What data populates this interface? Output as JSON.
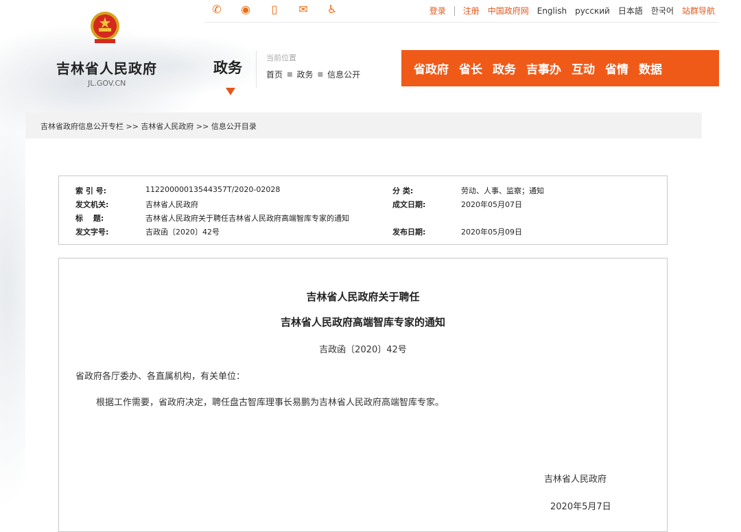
{
  "header": {
    "social_icons": [
      {
        "icon": "wechat-icon",
        "glyph": "✆"
      },
      {
        "icon": "weibo-icon",
        "glyph": "◉"
      },
      {
        "icon": "mobile-icon",
        "glyph": "▯"
      },
      {
        "icon": "mail-icon",
        "glyph": "✉"
      },
      {
        "icon": "accessibility-icon",
        "glyph": "♿"
      }
    ],
    "links": {
      "login": "登录",
      "register": "注册",
      "gov_portal": "中国政府网",
      "english": "English",
      "russian": "русский",
      "japanese": "日本語",
      "korean": "한국어",
      "sitemap": "站群导航"
    },
    "site_title": "吉林省人民政府",
    "site_domain": "JL.GOV.CN",
    "section": "政务",
    "location_label": "当前位置",
    "location_path": [
      "首页",
      "政务",
      "信息公开"
    ],
    "nav": [
      "省政府",
      "省长",
      "政务",
      "吉事办",
      "互动",
      "省情",
      "数据"
    ],
    "accent_color": "#f05a18"
  },
  "breadcrumb": "吉林省政府信息公开专栏 >> 吉林省人民政府 >> 信息公开目录",
  "meta": {
    "index_label": "索 引 号:",
    "index_value": "11220000013544357T/2020-02028",
    "category_label": "分 类:",
    "category_value": "劳动、人事、监察；通知",
    "issuer_label": "发文机关:",
    "issuer_value": "吉林省人民政府",
    "written_label": "成文日期:",
    "written_value": "2020年05月07日",
    "title_label": "标　 题:",
    "title_value": "吉林省人民政府关于聘任吉林省人民政府高端智库专家的通知",
    "docno_label": "发文字号:",
    "docno_value": "吉政函〔2020〕42号",
    "publish_label": "发布日期:",
    "publish_value": "2020年05月09日"
  },
  "document": {
    "title_line1": "吉林省人民政府关于聘任",
    "title_line2": "吉林省人民政府高端智库专家的通知",
    "doc_no": "吉政函〔2020〕42号",
    "salutation": "省政府各厅委办、各直属机构，有关单位：",
    "body": "根据工作需要，省政府决定，聘任盘古智库理事长易鹏为吉林省人民政府高端智库专家。",
    "signature": "吉林省人民政府",
    "date": "2020年5月7日"
  }
}
